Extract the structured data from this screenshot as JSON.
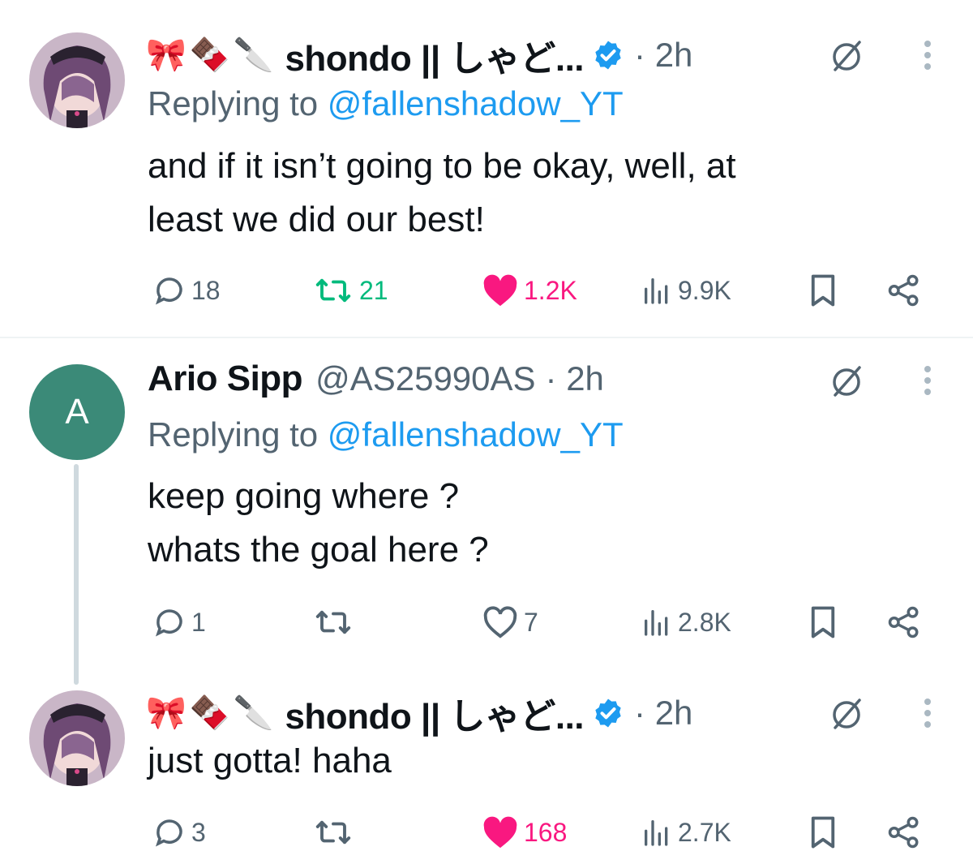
{
  "tweets": [
    {
      "author": {
        "emojis": [
          "🎀",
          "🍫",
          "🔪"
        ],
        "display_name": "shondo || しゃど...",
        "verified": true,
        "avatar_icon": "anime-avatar"
      },
      "time": "· 2h",
      "replying_label": "Replying to ",
      "replying_to": "@fallenshadow_YT",
      "text": "and if it isn’t going to be okay, well, at\nleast we did our best!",
      "stats": {
        "replies": "18",
        "reposts": "21",
        "likes": "1.2K",
        "views": "9.9K"
      },
      "reposted": true,
      "liked": true
    },
    {
      "author": {
        "avatar_letter": "A",
        "display_name": "Ario Sipp",
        "handle": "@AS25990AS"
      },
      "time": "· 2h",
      "replying_label": "Replying to ",
      "replying_to": "@fallenshadow_YT",
      "text": "keep going where ?\nwhats the goal here ?",
      "stats": {
        "replies": "1",
        "reposts": "",
        "likes": "7",
        "views": "2.8K"
      },
      "reposted": false,
      "liked": false
    },
    {
      "author": {
        "emojis": [
          "🎀",
          "🍫",
          "🔪"
        ],
        "display_name": "shondo || しゃど...",
        "verified": true,
        "avatar_icon": "anime-avatar"
      },
      "time": "· 2h",
      "text": "just gotta! haha",
      "stats": {
        "replies": "3",
        "reposts": "",
        "likes": "168",
        "views": "2.7K"
      },
      "reposted": false,
      "liked": true
    }
  ],
  "colors": {
    "accent": "#1d9bf0",
    "repost_active": "#00ba7c",
    "like_active": "#f91880",
    "muted": "#536471",
    "avatar_letter_bg": "#3b8a78"
  }
}
